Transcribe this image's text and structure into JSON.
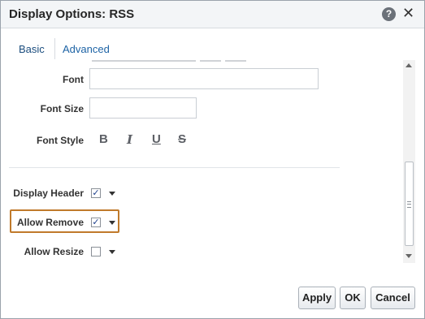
{
  "dialog": {
    "title": "Display Options: RSS"
  },
  "title_icons": {
    "help": "question-mark-icon",
    "close": "close-x-icon"
  },
  "tabs": [
    {
      "label": "Basic",
      "selected": true
    },
    {
      "label": "Advanced",
      "selected": false
    }
  ],
  "font": {
    "label": "Font",
    "value": ""
  },
  "font_size": {
    "label": "Font Size",
    "value": ""
  },
  "font_style": {
    "label": "Font Style",
    "buttons": [
      {
        "glyph": "B",
        "name": "bold"
      },
      {
        "glyph": "I",
        "name": "italic"
      },
      {
        "glyph": "U",
        "name": "underline"
      },
      {
        "glyph": "S",
        "name": "strikethrough"
      }
    ]
  },
  "options": [
    {
      "label": "Display Header",
      "checked": true,
      "highlighted": false
    },
    {
      "label": "Allow Remove",
      "checked": true,
      "highlighted": true
    },
    {
      "label": "Allow Resize",
      "checked": false,
      "highlighted": false
    }
  ],
  "buttons": {
    "apply": "Apply",
    "ok": "OK",
    "cancel": "Cancel"
  },
  "colors": {
    "tab_active": "#1b4d7e",
    "highlight_border": "#c07a2b",
    "titlebar_bg": "#f3f5f7"
  }
}
